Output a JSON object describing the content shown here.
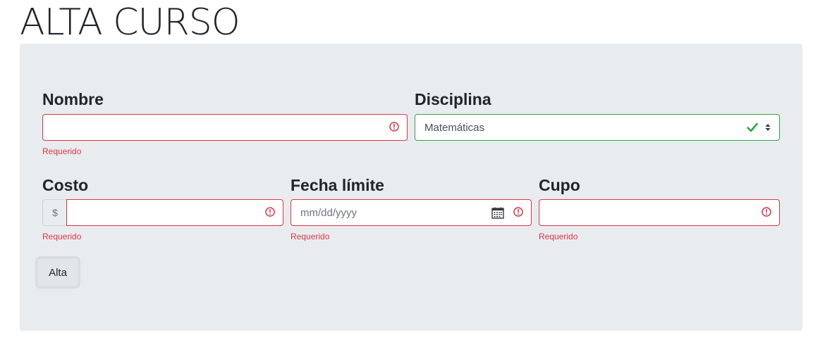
{
  "page": {
    "title": "ALTA CURSO"
  },
  "form": {
    "nombre": {
      "label": "Nombre",
      "value": "",
      "feedback": "Requerido"
    },
    "disciplina": {
      "label": "Disciplina",
      "selected": "Matemáticas"
    },
    "costo": {
      "label": "Costo",
      "prefix": "$",
      "value": "",
      "feedback": "Requerido"
    },
    "fecha_limite": {
      "label": "Fecha límite",
      "placeholder": "mm/dd/yyyy",
      "feedback": "Requerido"
    },
    "cupo": {
      "label": "Cupo",
      "value": "",
      "feedback": "Requerido"
    },
    "submit_label": "Alta"
  },
  "colors": {
    "invalid": "#dc3545",
    "valid": "#28a745",
    "panel": "#e9ecef"
  },
  "icons": {
    "invalid": "exclamation-circle-icon",
    "valid": "check-icon",
    "select": "sort-arrows-icon",
    "date": "calendar-icon"
  }
}
